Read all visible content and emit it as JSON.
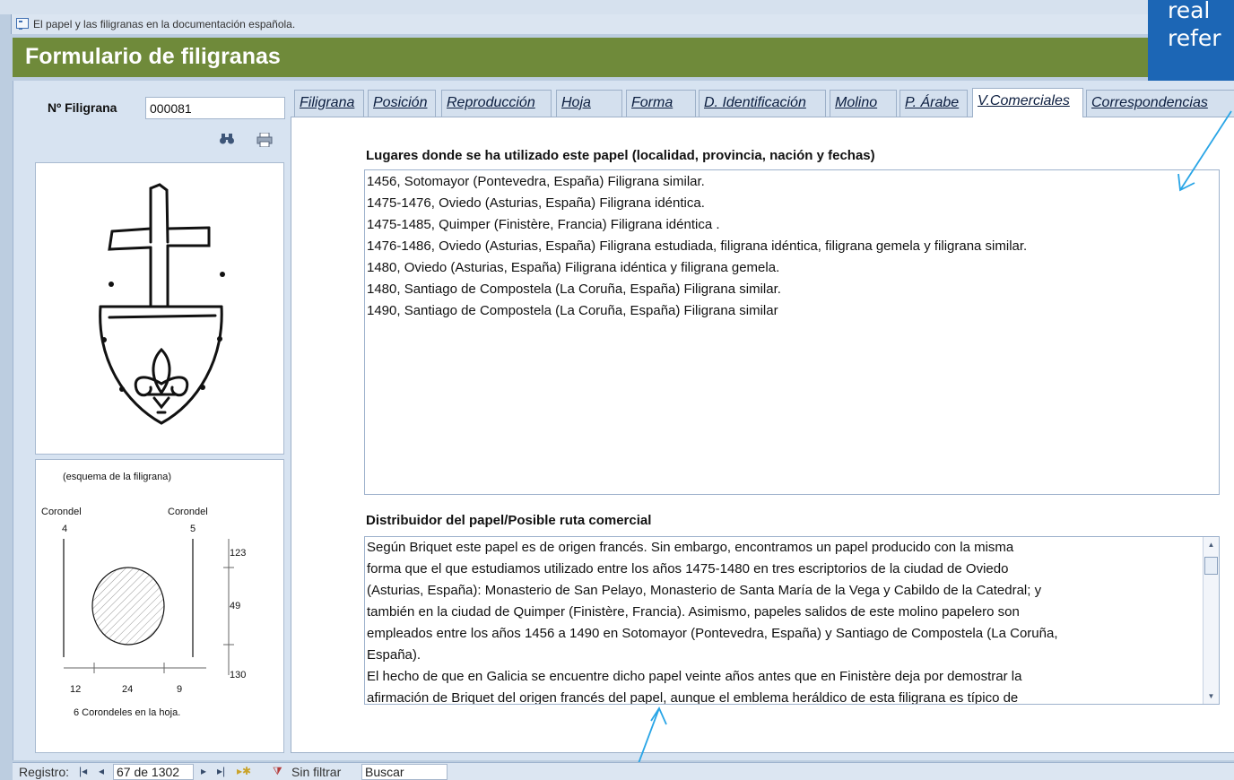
{
  "window": {
    "title": "El papel y las filigranas en la documentación española."
  },
  "header": {
    "title": "Formulario de filigranas"
  },
  "callout": {
    "line1": "real",
    "line2": "refer"
  },
  "form": {
    "filigrana_label": "Nº Filigrana",
    "filigrana_value": "000081"
  },
  "tabs": [
    {
      "label": "Filigrana"
    },
    {
      "label": "Posición"
    },
    {
      "label": "Reproducción"
    },
    {
      "label": "Hoja"
    },
    {
      "label": "Forma"
    },
    {
      "label": "D. Identificación"
    },
    {
      "label": "Molino"
    },
    {
      "label": "P. Árabe"
    },
    {
      "label": "V.Comerciales"
    },
    {
      "label": "Correspondencias"
    }
  ],
  "active_tab": "V.Comerciales",
  "lugares": {
    "label": "Lugares donde se ha utilizado este papel (localidad, provincia, nación y fechas)",
    "lines": [
      "1456, Sotomayor (Pontevedra, España) Filigrana similar.",
      "1475-1476, Oviedo (Asturias, España) Filigrana idéntica.",
      "1475-1485, Quimper (Finistère, Francia) Filigrana idéntica .",
      "1476-1486, Oviedo (Asturias, España) Filigrana estudiada, filigrana idéntica, filigrana gemela y filigrana similar.",
      "1480, Oviedo (Asturias, España) Filigrana idéntica y filigrana gemela.",
      "1480, Santiago de Compostela (La Coruña, España) Filigrana similar.",
      "1490, Santiago de Compostela (La Coruña, España) Filigrana similar"
    ]
  },
  "distribuidor": {
    "label": "Distribuidor del papel/Posible ruta comercial",
    "lines": [
      "Según Briquet este papel es de origen francés. Sin embargo, encontramos un papel producido con la misma",
      "forma que el que estudiamos utilizado entre los años 1475-1480 en tres escriptorios de la ciudad de Oviedo",
      "(Asturias, España): Monasterio de San Pelayo, Monasterio de Santa María de la Vega y Cabildo de la Catedral; y",
      "también en la ciudad de Quimper (Finistère, Francia). Asimismo, papeles salidos de este molino papelero son",
      "empleados entre los años 1456 a 1490 en Sotomayor (Pontevedra, España) y Santiago de Compostela (La Coruña,",
      "España).",
      "El hecho de que en Galicia se encuentre dicho papel veinte años antes que en Finistère deja por demostrar la",
      "afirmación de Briquet del origen francés del papel, aunque el emblema heráldico de esta filigrana es típico de"
    ]
  },
  "scheme": {
    "caption": "(esquema de la filigrana)",
    "corondel_left": "Corondel",
    "corondel_left_num": "4",
    "corondel_right": "Corondel",
    "corondel_right_num": "5",
    "dim_right": [
      "123",
      "49",
      "130"
    ],
    "dim_bottom": [
      "12",
      "24",
      "9"
    ],
    "footer": "6  Corondeles en la hoja."
  },
  "statusbar": {
    "registro_label": "Registro:",
    "record_value": "67 de 1302",
    "filter_label": "Sin filtrar",
    "search_label": "Buscar"
  }
}
